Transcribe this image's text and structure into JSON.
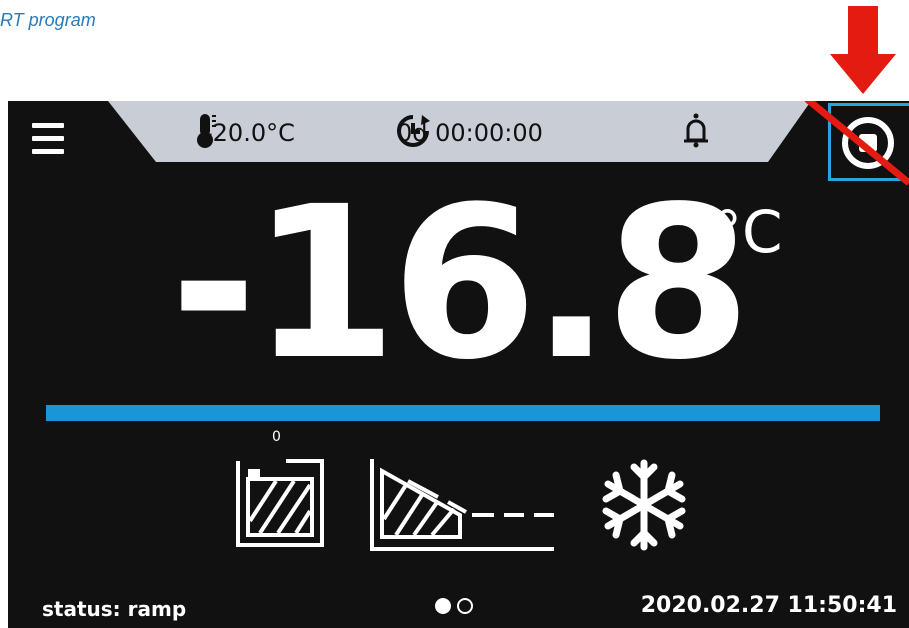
{
  "caption": "RT program",
  "topbar": {
    "setpoint_temp": "-20.0°C",
    "timer": "0d 00:00:00"
  },
  "main": {
    "current_temp": "-16.8",
    "unit": "°C",
    "segment_number": "0",
    "progress_fraction": 1.0
  },
  "footer": {
    "status": "status: ramp",
    "datetime": "2020.02.27  11:50:41",
    "page_dots": [
      "active",
      "inactive"
    ]
  },
  "colors": {
    "background": "#111111",
    "topbar": "#c9cdd6",
    "accent_blue": "#1a95d8",
    "highlight_border": "#2aa3e0",
    "annotation_red": "#e31b10",
    "caption": "#2a7ab8"
  },
  "icons": {
    "menu": "menu-icon",
    "thermometer": "thermometer-icon",
    "timer": "timer-icon",
    "bell": "bell-icon",
    "stop": "stop-icon",
    "segment_program": "hatched-box-icon",
    "ramp": "ramp-icon",
    "cooling": "snowflake-icon"
  }
}
